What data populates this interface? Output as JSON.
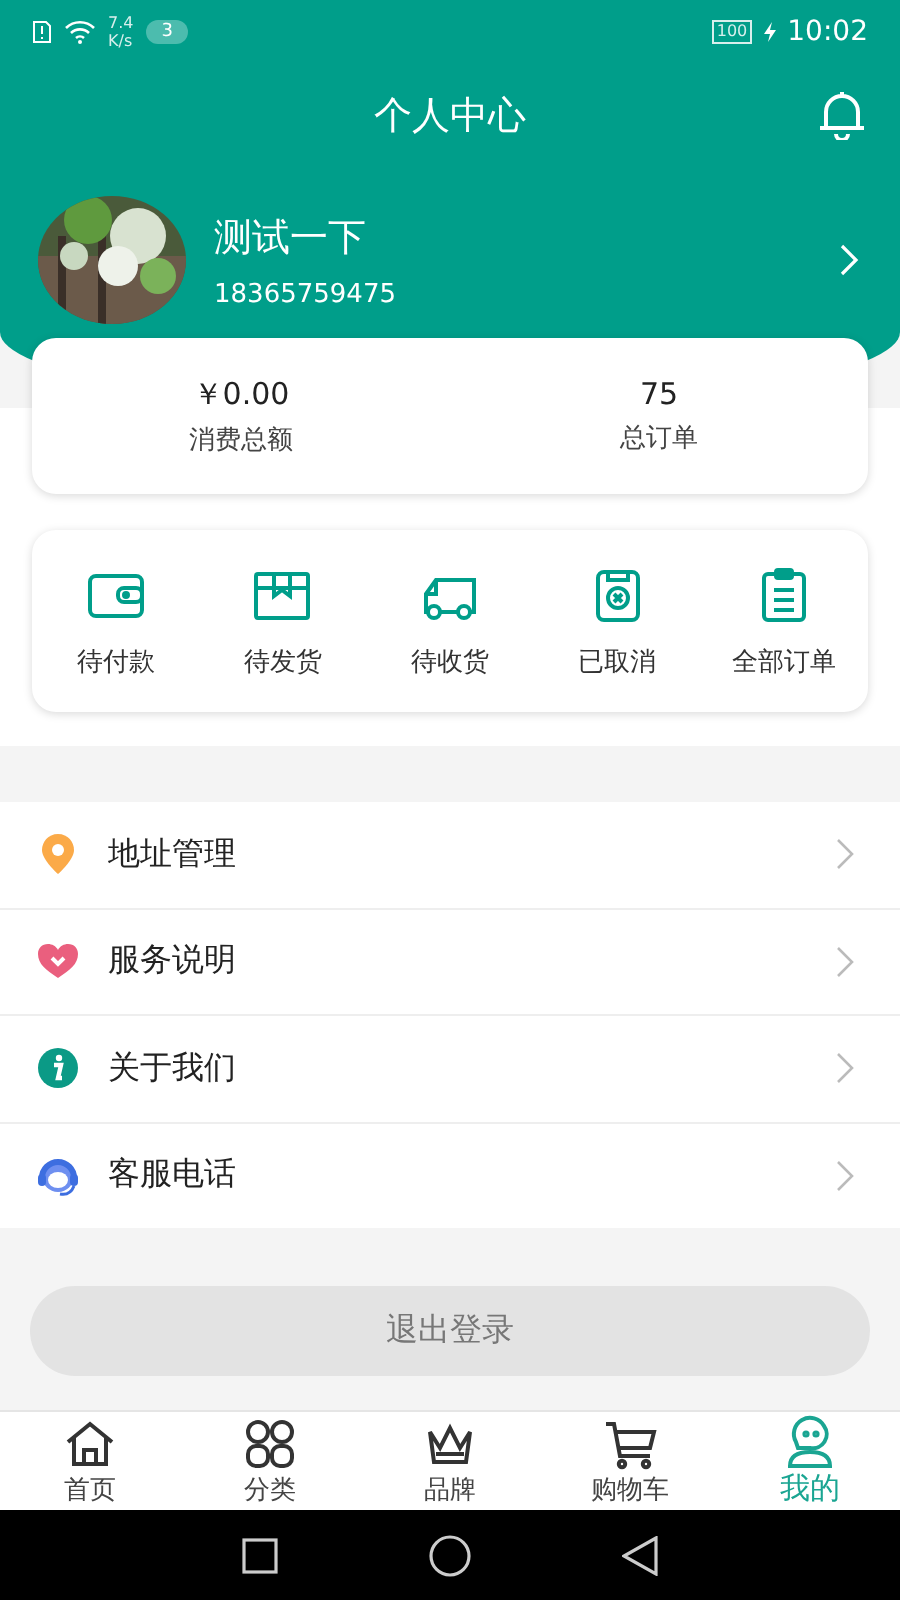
{
  "status_bar": {
    "speed_value": "7.4",
    "speed_unit": "K/s",
    "notification_count": "3",
    "battery": "100",
    "time": "10:02"
  },
  "header": {
    "title": "个人中心"
  },
  "profile": {
    "name": "测试一下",
    "phone": "18365759475"
  },
  "stats": [
    {
      "value": "￥0.00",
      "label": "消费总额"
    },
    {
      "value": "75",
      "label": "总订单"
    }
  ],
  "orders": [
    {
      "kind": "wallet",
      "label": "待付款"
    },
    {
      "kind": "box",
      "label": "待发货"
    },
    {
      "kind": "truck",
      "label": "待收货"
    },
    {
      "kind": "cancel",
      "label": "已取消"
    },
    {
      "kind": "clipboard",
      "label": "全部订单"
    }
  ],
  "menu": [
    {
      "kind": "location",
      "label": "地址管理"
    },
    {
      "kind": "heart",
      "label": "服务说明"
    },
    {
      "kind": "info",
      "label": "关于我们"
    },
    {
      "kind": "headset",
      "label": "客服电话"
    }
  ],
  "logout_button": "退出登录",
  "tab_bar": [
    {
      "kind": "home",
      "label": "首页",
      "selected": false
    },
    {
      "kind": "grid",
      "label": "分类",
      "selected": false
    },
    {
      "kind": "crown",
      "label": "品牌",
      "selected": false
    },
    {
      "kind": "cart",
      "label": "购物车",
      "selected": false
    },
    {
      "kind": "user",
      "label": "我的",
      "selected": true
    }
  ]
}
